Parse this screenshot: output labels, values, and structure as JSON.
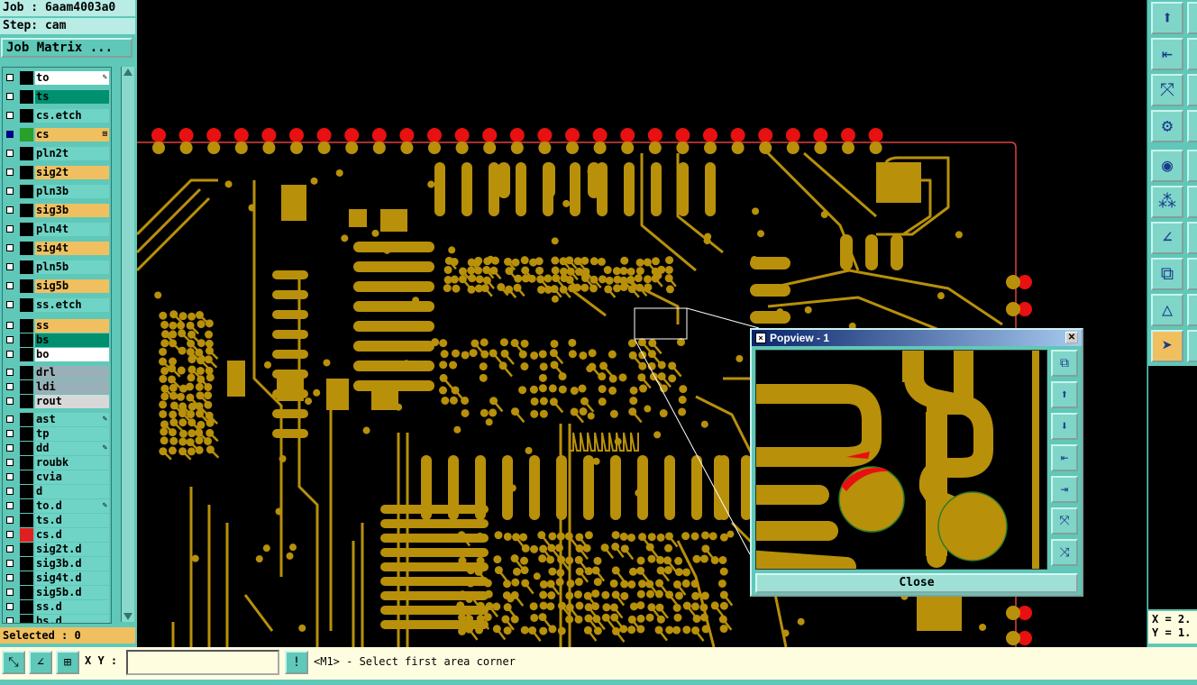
{
  "job": {
    "job_label": "Job : 6aam4003a0",
    "step_label": "Step: cam",
    "job_matrix_button": "Job Matrix ..."
  },
  "layers": [
    {
      "name": "to",
      "color": "#ffffff",
      "mark": "✎"
    },
    {
      "name": "ts",
      "color": "#009070",
      "mark": ""
    },
    {
      "name": "cs.etch",
      "color": "#6fd4c6",
      "mark": ""
    },
    {
      "name": "cs",
      "color": "#f0c060",
      "mark": "⊞",
      "active": true,
      "swatch": "#2aa02a"
    },
    {
      "name": "pln2t",
      "color": "#6fd4c6",
      "mark": ""
    },
    {
      "name": "sig2t",
      "color": "#f0c060",
      "mark": ""
    },
    {
      "name": "pln3b",
      "color": "#6fd4c6",
      "mark": ""
    },
    {
      "name": "sig3b",
      "color": "#f0c060",
      "mark": ""
    },
    {
      "name": "pln4t",
      "color": "#6fd4c6",
      "mark": ""
    },
    {
      "name": "sig4t",
      "color": "#f0c060",
      "mark": ""
    },
    {
      "name": "pln5b",
      "color": "#6fd4c6",
      "mark": ""
    },
    {
      "name": "sig5b",
      "color": "#f0c060",
      "mark": ""
    },
    {
      "name": "ss.etch",
      "color": "#6fd4c6",
      "mark": ""
    },
    {
      "name": "ss",
      "color": "#f0c060",
      "mark": ""
    },
    {
      "name": "bs",
      "color": "#009070",
      "mark": ""
    },
    {
      "name": "bo",
      "color": "#ffffff",
      "mark": ""
    },
    {
      "name": "drl",
      "color": "#9ab0b8",
      "mark": ""
    },
    {
      "name": "ldi",
      "color": "#9ab0b8",
      "mark": ""
    },
    {
      "name": "rout",
      "color": "#d8d8d8",
      "mark": ""
    },
    {
      "name": "ast",
      "color": "#6fd4c6",
      "mark": "✎"
    },
    {
      "name": "tp",
      "color": "#6fd4c6",
      "mark": ""
    },
    {
      "name": "dd",
      "color": "#6fd4c6",
      "mark": "✎"
    },
    {
      "name": "roubk",
      "color": "#6fd4c6",
      "mark": ""
    },
    {
      "name": "cvia",
      "color": "#6fd4c6",
      "mark": ""
    },
    {
      "name": "d",
      "color": "#6fd4c6",
      "mark": ""
    },
    {
      "name": "to.d",
      "color": "#6fd4c6",
      "mark": "✎"
    },
    {
      "name": "ts.d",
      "color": "#6fd4c6",
      "mark": ""
    },
    {
      "name": "cs.d",
      "color": "#6fd4c6",
      "mark": "",
      "swatch": "#e02020"
    },
    {
      "name": "sig2t.d",
      "color": "#6fd4c6",
      "mark": ""
    },
    {
      "name": "sig3b.d",
      "color": "#6fd4c6",
      "mark": ""
    },
    {
      "name": "sig4t.d",
      "color": "#6fd4c6",
      "mark": ""
    },
    {
      "name": "sig5b.d",
      "color": "#6fd4c6",
      "mark": ""
    },
    {
      "name": "ss.d",
      "color": "#6fd4c6",
      "mark": ""
    },
    {
      "name": "bs.d",
      "color": "#6fd4c6",
      "mark": ""
    }
  ],
  "selected_label": "Selected : 0",
  "bottom": {
    "xy_label": "X Y :",
    "xy_value": "",
    "status_message": "<M1> - Select first area corner"
  },
  "popview": {
    "title": "Popview - 1",
    "close_button": "Close"
  },
  "coords": {
    "x_label": "X = 2.",
    "y_label": "Y = 1."
  },
  "colors": {
    "panel": "#5fc8b8",
    "copper": "#b8900a",
    "pad_red": "#e81010",
    "background": "#000000"
  },
  "tools": [
    "frame-up-icon",
    "frame-left-icon",
    "fit-icon",
    "settings-icon",
    "snap-icon",
    "nodes-icon",
    "measure-icon",
    "select-icon",
    "triangle-icon",
    "pointer-icon"
  ]
}
